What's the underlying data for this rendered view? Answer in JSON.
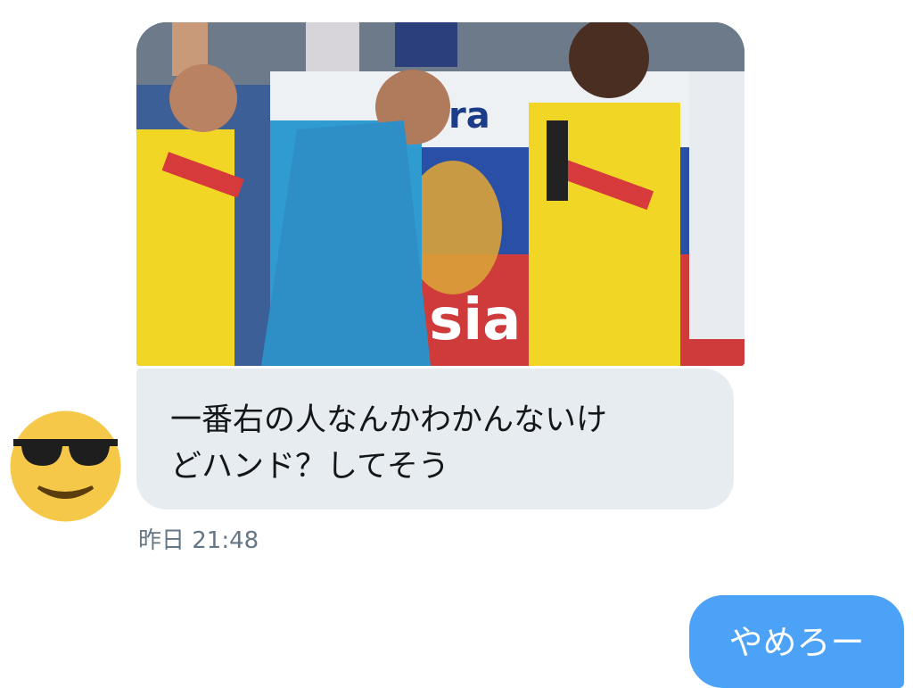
{
  "conversation": {
    "incoming": {
      "image_overlay_text": "ssia",
      "image_sign_text": "ra",
      "message_lines": [
        "一番右の人なんかわかんないけ",
        "どハンド？してそう"
      ],
      "timestamp": "昨日 21:48",
      "avatar_icon": "sunglasses-emoji-icon"
    },
    "outgoing": {
      "message": "やめろー"
    }
  },
  "colors": {
    "incoming_bubble": "#e6ecf0",
    "outgoing_bubble": "#4ca2f7",
    "timestamp_text": "#657786",
    "avatar_face": "#f6c84a"
  }
}
